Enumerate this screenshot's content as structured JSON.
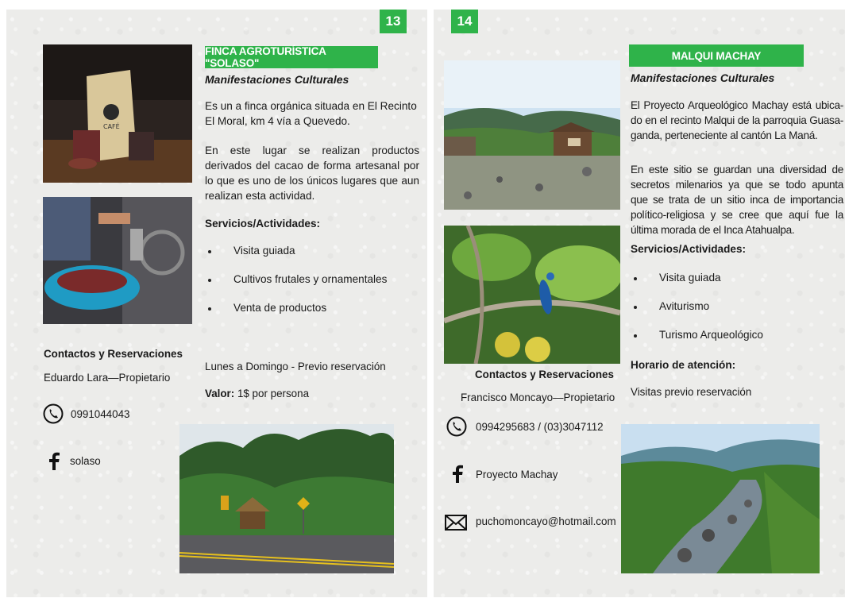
{
  "left": {
    "page_number": "13",
    "title": "FINCA AGROTURÍSTICA \"SOLASO\"",
    "subtitle": "Manifestaciones Culturales",
    "paragraph1": "Es un a finca orgánica situada en El Recinto El Moral, km 4 vía a Quevedo.",
    "paragraph2": "En este lugar se realizan productos derivados del cacao de forma artesanal por lo que es uno de los únicos lugares que aun realizan esta actividad.",
    "services_heading": "Servicios/Actividades:",
    "services": [
      "Visita guiada",
      "Cultivos frutales y ornamentales",
      "Venta de productos"
    ],
    "schedule": "Lunes a Domingo - Previo reservación",
    "price_label": "Valor:",
    "price_value": " 1$ por persona",
    "contacts_heading": "Contactos y Reservaciones",
    "contact_person": "Eduardo Lara—Propietario",
    "phone": "0991044043",
    "facebook": "solaso",
    "photo_labels": {
      "bag": "CAFÉ"
    }
  },
  "right": {
    "page_number": "14",
    "title": "MALQUI MACHAY",
    "subtitle": "Manifestaciones Culturales",
    "paragraph1": "El Proyecto Arqueológico Machay está ubica-do en el recinto Malqui de la parroquia Guasa-ganda, perteneciente al cantón La Maná.",
    "paragraph2": "En este sitio se guardan una diversidad de secretos milenarios ya que se todo apunta que se trata de un sitio inca de importancia político-religiosa y se cree que aquí fue la última morada de el Inca Atahualpa.",
    "services_heading": "Servicios/Actividades:",
    "services": [
      "Visita guiada",
      "Aviturismo",
      "Turismo Arqueológico"
    ],
    "hours_heading": "Horario de atención:",
    "hours": "Visitas previo reservación",
    "contacts_heading": "Contactos y Reservaciones",
    "contact_person": "Francisco Moncayo—Propietario",
    "phone": "0994295683 / (03)3047112",
    "facebook": "Proyecto Machay",
    "email": "puchomoncayo@hotmail.com"
  },
  "colors": {
    "accent": "#2fb34a",
    "paper": "#ececea",
    "text": "#1a1a1a"
  },
  "icons": [
    "phone-icon",
    "facebook-icon",
    "mail-icon"
  ]
}
